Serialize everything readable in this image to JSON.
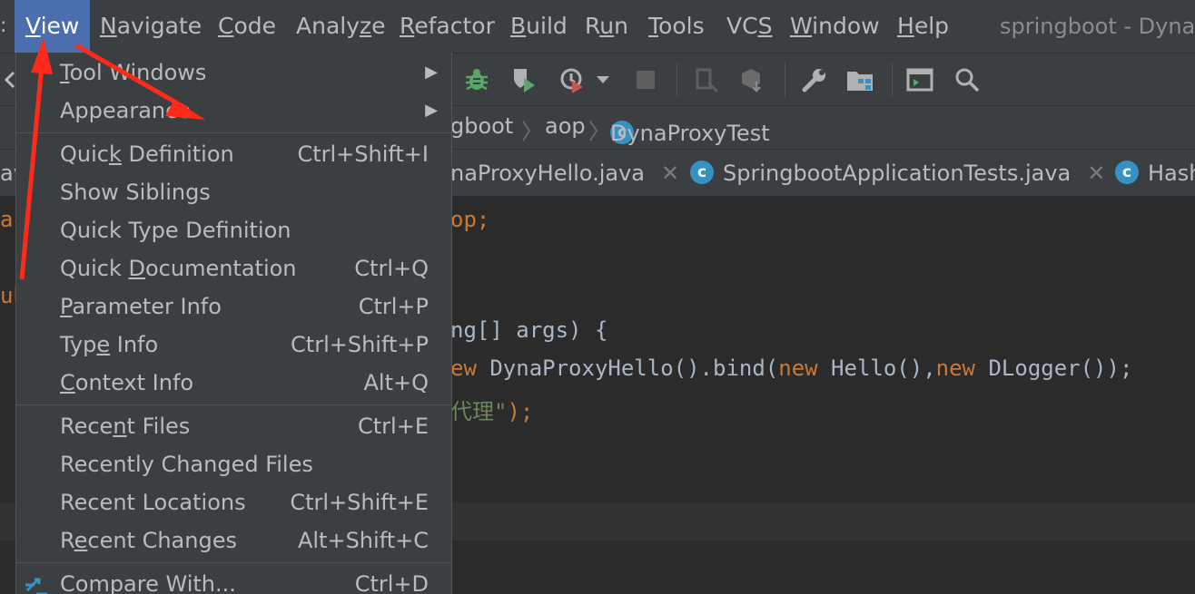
{
  "menubar": {
    "items": [
      {
        "label": "View",
        "mnemonic": "V",
        "rest": "iew",
        "active": true
      },
      {
        "label": "Navigate",
        "mnemonic": "N",
        "rest": "avigate"
      },
      {
        "label": "Code",
        "mnemonic": "C",
        "rest": "ode"
      },
      {
        "label": "Analyze",
        "pre": "Analy",
        "mnemonic": "z",
        "rest": "e"
      },
      {
        "label": "Refactor",
        "mnemonic": "R",
        "rest": "efactor"
      },
      {
        "label": "Build",
        "mnemonic": "B",
        "rest": "uild"
      },
      {
        "label": "Run",
        "pre": "R",
        "mnemonic": "u",
        "rest": "n"
      },
      {
        "label": "Tools",
        "mnemonic": "T",
        "rest": "ools"
      },
      {
        "label": "VCS",
        "pre": "VC",
        "mnemonic": "S",
        "rest": ""
      },
      {
        "label": "Window",
        "mnemonic": "W",
        "rest": "indow"
      },
      {
        "label": "Help",
        "mnemonic": "H",
        "rest": "elp"
      }
    ],
    "window_title": "springboot - DynaP"
  },
  "navbar": {
    "crumbs": [
      "gboot",
      "aop",
      "DynaProxyTest"
    ]
  },
  "tabs": [
    {
      "label": "av"
    },
    {
      "label": "naProxyHello.java"
    },
    {
      "label": "SpringbootApplicationTests.java"
    },
    {
      "label": "Hash"
    }
  ],
  "editor": {
    "left_fragments": [
      "ac",
      "ub"
    ],
    "line1": "op;",
    "line4_a": "ng[] args) {",
    "line5_kw1": "ew",
    "line5_a": " DynaProxyHello().bind(",
    "line5_kw2": "new",
    "line5_b": " Hello(),",
    "line5_kw3": "new",
    "line5_c": " DLogger());",
    "line6_str": "代理\"",
    "line6_end": ");"
  },
  "view_menu": {
    "groups": [
      [
        {
          "label": "Tool Windows",
          "pre": "",
          "mn": "T",
          "rest": "ool Windows",
          "submenu": true
        },
        {
          "label": "Appearance",
          "pre": "",
          "mn": "",
          "rest": "Appearance",
          "submenu": true
        }
      ],
      [
        {
          "label": "Quick Definition",
          "pre": "Quic",
          "mn": "k",
          "rest": " Definition",
          "shortcut": "Ctrl+Shift+I"
        },
        {
          "label": "Show Siblings",
          "pre": "",
          "mn": "",
          "rest": "Show Siblings",
          "shortcut": ""
        },
        {
          "label": "Quick Type Definition",
          "pre": "",
          "mn": "",
          "rest": "Quick Type Definition",
          "shortcut": ""
        },
        {
          "label": "Quick Documentation",
          "pre": "Quick ",
          "mn": "D",
          "rest": "ocumentation",
          "shortcut": "Ctrl+Q"
        },
        {
          "label": "Parameter Info",
          "pre": "",
          "mn": "P",
          "rest": "arameter Info",
          "shortcut": "Ctrl+P"
        },
        {
          "label": "Type Info",
          "pre": "Typ",
          "mn": "e",
          "rest": " Info",
          "shortcut": "Ctrl+Shift+P"
        },
        {
          "label": "Context Info",
          "pre": "",
          "mn": "C",
          "rest": "ontext Info",
          "shortcut": "Alt+Q"
        }
      ],
      [
        {
          "label": "Recent Files",
          "pre": "Rece",
          "mn": "n",
          "rest": "t Files",
          "shortcut": "Ctrl+E"
        },
        {
          "label": "Recently Changed Files",
          "pre": "",
          "mn": "",
          "rest": "Recently Changed Files",
          "shortcut": ""
        },
        {
          "label": "Recent Locations",
          "pre": "",
          "mn": "",
          "rest": "Recent Locations",
          "shortcut": "Ctrl+Shift+E"
        },
        {
          "label": "Recent Changes",
          "pre": "R",
          "mn": "e",
          "rest": "cent Changes",
          "shortcut": "Alt+Shift+C"
        }
      ],
      [
        {
          "label": "Compare With...",
          "pre": "",
          "mn": "",
          "rest": "Compare With...",
          "shortcut": "Ctrl+D",
          "icon": "compare-icon"
        }
      ]
    ]
  },
  "colors": {
    "menubar_bg": "#3c3f41",
    "menu_active": "#4b6eaf",
    "editor_bg": "#2b2b2b",
    "keyword": "#cc7832",
    "annotation_red": "#ff2a1a"
  }
}
